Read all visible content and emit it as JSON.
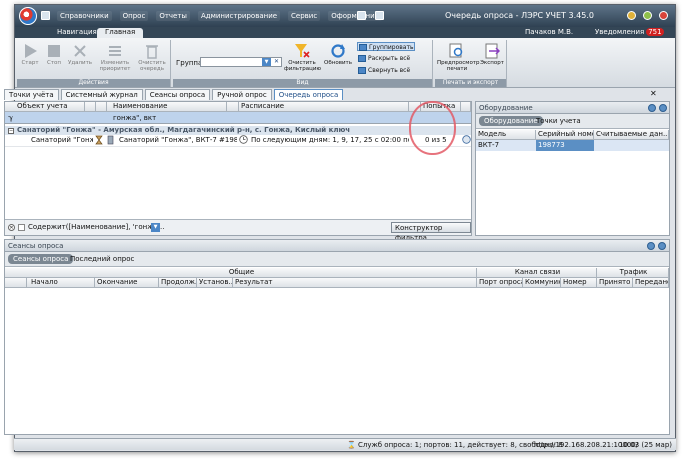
{
  "app": {
    "title": "Очередь опроса - ЛЭРС УЧЕТ 3.45.0",
    "menu": [
      "Справочники",
      "Опрос",
      "Отчеты",
      "Администрирование",
      "Сервис",
      "Оформление"
    ],
    "user": "Пачаков М.В.",
    "notifications_label": "Уведомления",
    "notifications_count": "751",
    "accent_color": "#5b8fc4"
  },
  "ribbon": {
    "tabs": [
      "Навигация",
      "Главная"
    ],
    "actions": {
      "caption": "Действия",
      "buttons": [
        "Старт",
        "Стоп",
        "Удалить",
        "Изменить приоритет",
        "Очистить очередь"
      ]
    },
    "view": {
      "caption": "Вид",
      "group_label": "Группа:",
      "group_value": "",
      "clear_filter": "Очистить фильтрацию",
      "refresh": "Обновить",
      "group_btn": "Группировать",
      "expand_all": "Раскрыть всё",
      "collapse_all": "Свернуть всё"
    },
    "print": {
      "caption": "Печать и экспорт",
      "preview": "Предпросмотр печати",
      "export": "Экспорт"
    }
  },
  "doc_tabs": [
    "Точки учёта",
    "Системный журнал",
    "Сеансы опроса",
    "Ручной опрос",
    "Очередь опроса"
  ],
  "queue": {
    "columns": [
      "Объект учета",
      "Наименование",
      "Расписание",
      "Попытка"
    ],
    "filter_value": "гонжа\", вкт",
    "group_row": "Санаторий \"Гонжа\" - Амурская обл., Магдагачинский р-н, с. Гонжа, Кислый ключ",
    "row": {
      "object": "Санаторий \"Гонжа\"",
      "name": "Санаторий \"Гонжа\", ВКТ-7 #198773, Се...",
      "schedule": "По следующим дням: 1, 9, 17, 25 с 02:00 по 23:59",
      "attempt": "0 из 5"
    },
    "filter_text": "Содержит([Наименование], 'гонжа...",
    "filter_builder": "Конструктор фильтра..."
  },
  "equipment": {
    "title": "Оборудование",
    "tabs": [
      "Оборудование",
      "Точки учета"
    ],
    "columns": [
      "Модель",
      "Серийный номер",
      "Считываемые дан..."
    ],
    "rows": [
      {
        "model": "ВКТ-7",
        "serial": "198773",
        "data": ""
      }
    ]
  },
  "sessions": {
    "title": "Сеансы опроса",
    "tabs": [
      "Сеансы опроса",
      "Последний опрос"
    ],
    "bands": [
      "Общие",
      "Канал связи",
      "Трафик"
    ],
    "columns": [
      "Начало",
      "Окончание",
      "Продолж...",
      "Установ...",
      "Результат",
      "Порт опроса",
      "Коммуник...",
      "Номер",
      "Принято",
      "Передано"
    ]
  },
  "status": {
    "service": "Служб опроса: 1; портов: 11, действует: 8, свободно: 8",
    "url": "http://192.168.208.21:10000/",
    "time": "10:03 (25 мар)"
  }
}
